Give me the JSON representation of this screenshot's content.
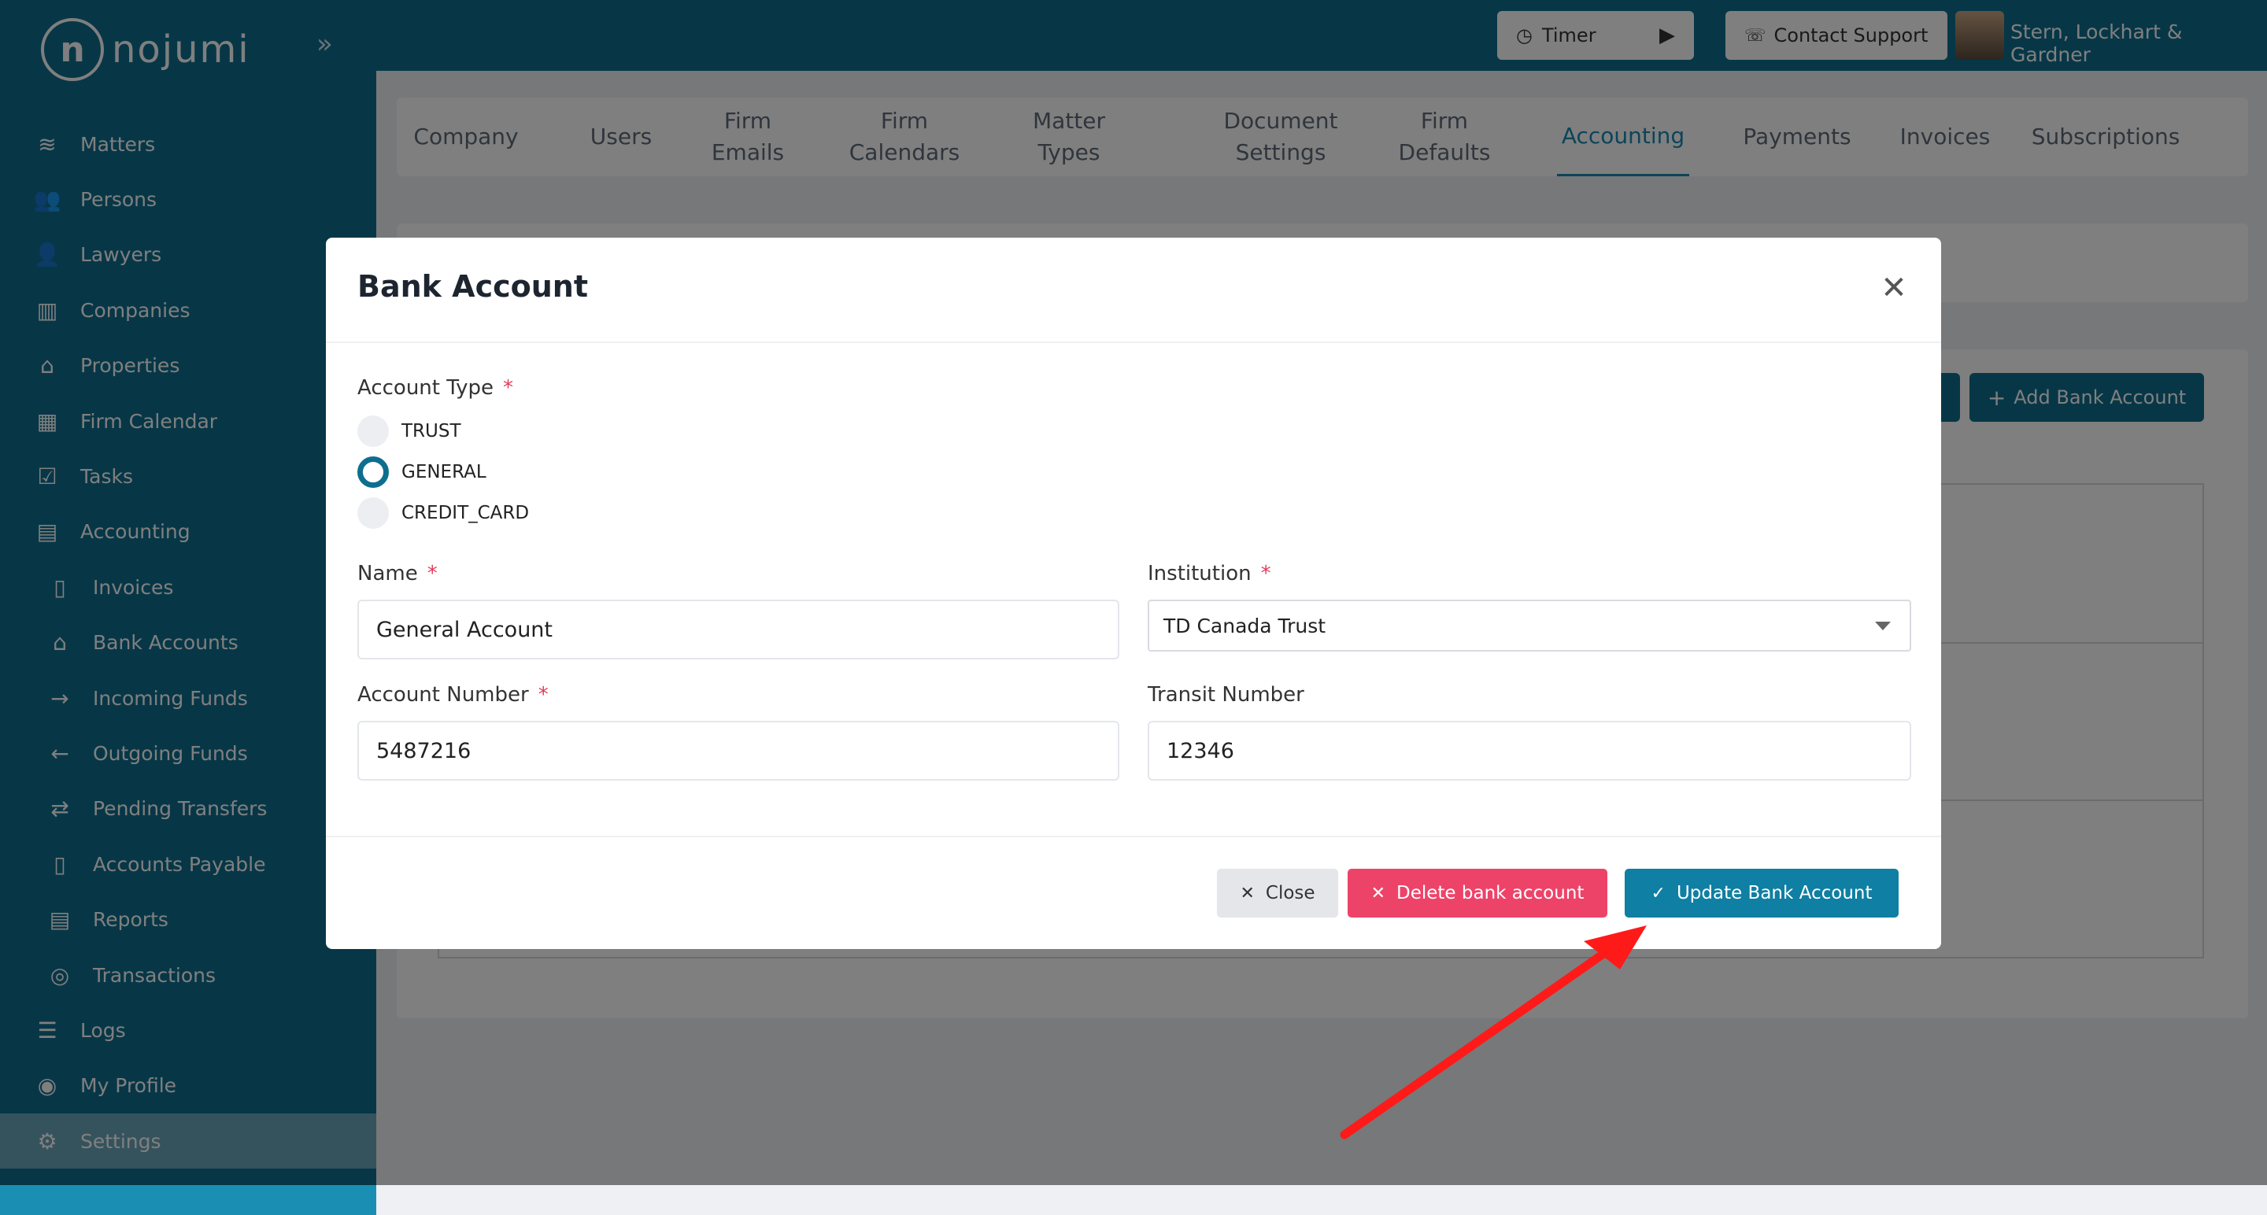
{
  "app": {
    "logo_mark": "n",
    "logo_text": "nojumi",
    "collapse_glyph": "»"
  },
  "sidebar": {
    "items": [
      {
        "label": "Matters",
        "icon": "layers-icon",
        "glyph": "≋"
      },
      {
        "label": "Persons",
        "icon": "users-icon",
        "glyph": "👥"
      },
      {
        "label": "Lawyers",
        "icon": "lawyer-icon",
        "glyph": "👤"
      },
      {
        "label": "Companies",
        "icon": "building-icon",
        "glyph": "▥"
      },
      {
        "label": "Properties",
        "icon": "home-icon",
        "glyph": "⌂"
      },
      {
        "label": "Firm Calendar",
        "icon": "calendar-icon",
        "glyph": "▦"
      },
      {
        "label": "Tasks",
        "icon": "checkbox-icon",
        "glyph": "☑"
      },
      {
        "label": "Accounting",
        "icon": "book-icon",
        "glyph": "▤"
      },
      {
        "label": "Invoices",
        "icon": "invoice-icon",
        "glyph": "▯"
      },
      {
        "label": "Bank Accounts",
        "icon": "bank-icon",
        "glyph": "⌂"
      },
      {
        "label": "Incoming Funds",
        "icon": "arrow-right-icon",
        "glyph": "→"
      },
      {
        "label": "Outgoing Funds",
        "icon": "arrow-left-icon",
        "glyph": "←"
      },
      {
        "label": "Pending Transfers",
        "icon": "transfer-icon",
        "glyph": "⇄"
      },
      {
        "label": "Accounts Payable",
        "icon": "payable-icon",
        "glyph": "▯"
      },
      {
        "label": "Reports",
        "icon": "report-icon",
        "glyph": "▤"
      },
      {
        "label": "Transactions",
        "icon": "coins-icon",
        "glyph": "◎"
      },
      {
        "label": "Logs",
        "icon": "list-icon",
        "glyph": "☰"
      },
      {
        "label": "My Profile",
        "icon": "profile-icon",
        "glyph": "◉"
      },
      {
        "label": "Settings",
        "icon": "gear-icon",
        "glyph": "⚙"
      }
    ]
  },
  "topbar": {
    "timer_label": "Timer",
    "timer_icon": "clock-icon",
    "play_icon": "play-icon",
    "support_label": "Contact Support",
    "support_icon": "headset-icon",
    "user_name": "Stern, Lockhart & Gardner"
  },
  "tabs": [
    {
      "label": "Company"
    },
    {
      "label": "Users"
    },
    {
      "label": "Firm\nEmails"
    },
    {
      "label": "Firm\nCalendars"
    },
    {
      "label": "Matter\nTypes"
    },
    {
      "label": "Document\nSettings"
    },
    {
      "label": "Firm\nDefaults"
    },
    {
      "label": "Accounting",
      "active": true
    },
    {
      "label": "Payments"
    },
    {
      "label": "Invoices"
    },
    {
      "label": "Subscriptions"
    }
  ],
  "background": {
    "add_bank_label": "Add Bank Account"
  },
  "modal": {
    "title": "Bank Account",
    "account_type_label": "Account Type",
    "required_mark": "*",
    "account_types": [
      "TRUST",
      "GENERAL",
      "CREDIT_CARD"
    ],
    "selected_account_type": "GENERAL",
    "name_label": "Name",
    "name_value": "General Account",
    "institution_label": "Institution",
    "institution_value": "TD Canada Trust",
    "account_number_label": "Account Number",
    "account_number_value": "5487216",
    "transit_number_label": "Transit Number",
    "transit_number_value": "12346",
    "close_label": "Close",
    "delete_label": "Delete bank account",
    "update_label": "Update Bank Account"
  },
  "colors": {
    "brand": "#0f6e8f",
    "accent": "#1a88b3",
    "danger": "#ee4369",
    "annotation_arrow": "#ff1a1a"
  }
}
